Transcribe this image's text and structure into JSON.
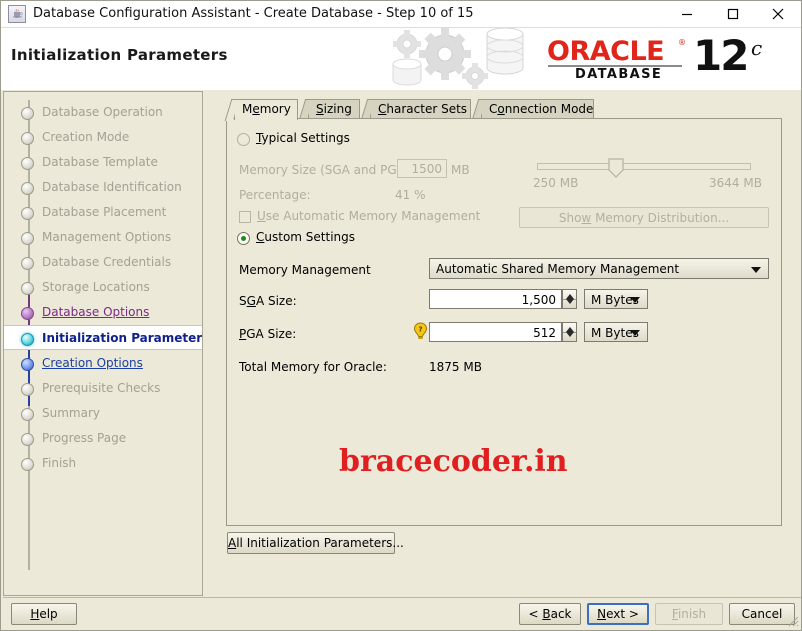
{
  "window": {
    "title": "Database Configuration Assistant - Create Database - Step 10 of 15",
    "icon": "java-cup-icon",
    "minimize_label": "Minimize",
    "maximize_label": "Maximize",
    "close_label": "Close"
  },
  "banner": {
    "heading": "Initialization Parameters",
    "logo_word": "ORACLE",
    "logo_reg": "®",
    "logo_sub": "DATABASE",
    "logo_version": "12",
    "logo_suffix": "c"
  },
  "sidebar": {
    "items": [
      {
        "label": "Database Operation",
        "state": "done"
      },
      {
        "label": "Creation Mode",
        "state": "done"
      },
      {
        "label": "Database Template",
        "state": "done"
      },
      {
        "label": "Database Identification",
        "state": "done"
      },
      {
        "label": "Database Placement",
        "state": "done"
      },
      {
        "label": "Management Options",
        "state": "done"
      },
      {
        "label": "Database Credentials",
        "state": "done"
      },
      {
        "label": "Storage Locations",
        "state": "done"
      },
      {
        "label": "Database Options",
        "state": "link"
      },
      {
        "label": "Initialization Parameters",
        "state": "active"
      },
      {
        "label": "Creation Options",
        "state": "link2"
      },
      {
        "label": "Prerequisite Checks",
        "state": "done"
      },
      {
        "label": "Summary",
        "state": "done"
      },
      {
        "label": "Progress Page",
        "state": "done"
      },
      {
        "label": "Finish",
        "state": "done"
      }
    ]
  },
  "tabs": [
    {
      "label": "Memory",
      "mnemonic": "e",
      "active": true
    },
    {
      "label": "Sizing",
      "mnemonic": "S",
      "active": false
    },
    {
      "label": "Character Sets",
      "mnemonic": "C",
      "active": false
    },
    {
      "label": "Connection Mode",
      "mnemonic": "o",
      "active": false
    }
  ],
  "memory_tab": {
    "typical": {
      "radio_label": "Typical Settings",
      "selected": false,
      "memory_size_label": "Memory Size (SGA and PGA):",
      "memory_size_value": "1500",
      "memory_size_unit": "MB",
      "percentage_label": "Percentage:",
      "percentage_value": "41 %",
      "amm_label": "Use Automatic Memory Management",
      "amm_checked": false,
      "show_distribution_label": "Show Memory Distribution...",
      "slider_min_label": "250 MB",
      "slider_max_label": "3644 MB",
      "slider_position_percent": 37
    },
    "custom": {
      "radio_label": "Custom Settings",
      "selected": true,
      "memory_management_label": "Memory Management",
      "memory_management_value": "Automatic Shared Memory Management",
      "sga_label": "SGA Size:",
      "sga_value": "1,500",
      "sga_unit": "M Bytes",
      "pga_label": "PGA Size:",
      "pga_value": "512",
      "pga_unit": "M Bytes",
      "pga_hint_icon": "lightbulb-hint-icon",
      "total_label": "Total Memory for Oracle:",
      "total_value": "1875 MB"
    }
  },
  "watermark": {
    "text": "bracecoder.in",
    "color": "#e02020"
  },
  "buttons": {
    "all_init_params": "All Initialization Parameters...",
    "help": "Help",
    "back": "< Back",
    "next": "Next >",
    "finish": "Finish",
    "cancel": "Cancel",
    "finish_enabled": false,
    "next_focused": true
  }
}
